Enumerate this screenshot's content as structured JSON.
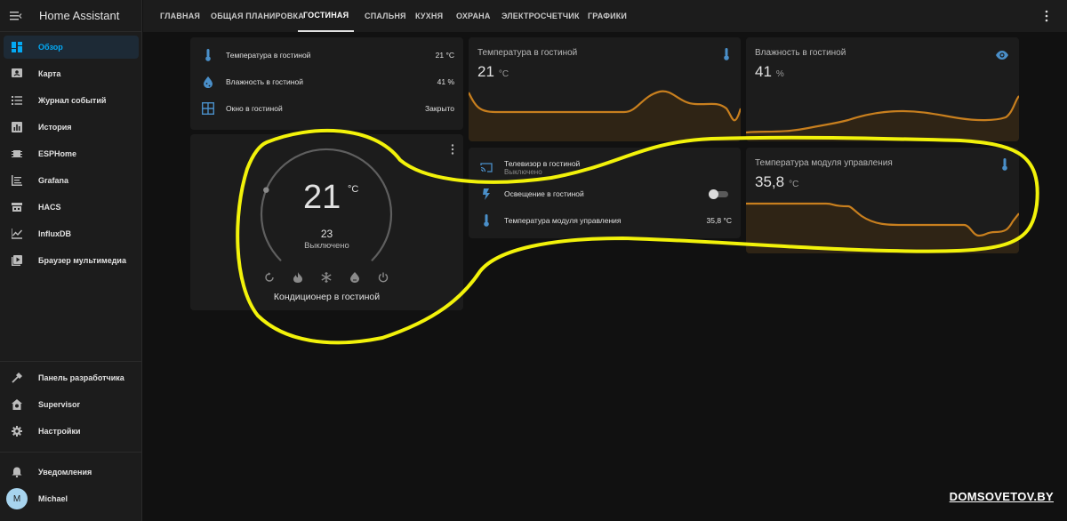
{
  "app": {
    "title": "Home Assistant"
  },
  "sidebar": {
    "items": [
      {
        "label": "Обзор",
        "icon": "dashboard-icon"
      },
      {
        "label": "Карта",
        "icon": "map-icon"
      },
      {
        "label": "Журнал событий",
        "icon": "logbook-icon"
      },
      {
        "label": "История",
        "icon": "history-icon"
      },
      {
        "label": "ESPHome",
        "icon": "esphome-icon"
      },
      {
        "label": "Grafana",
        "icon": "grafana-icon"
      },
      {
        "label": "HACS",
        "icon": "hacs-icon"
      },
      {
        "label": "InfluxDB",
        "icon": "influxdb-icon"
      },
      {
        "label": "Браузер мультимедиа",
        "icon": "media-browser-icon"
      }
    ],
    "bottom_items": [
      {
        "label": "Панель разработчика",
        "icon": "hammer-icon"
      },
      {
        "label": "Supervisor",
        "icon": "supervisor-icon"
      },
      {
        "label": "Настройки",
        "icon": "gear-icon"
      }
    ],
    "notifications": "Уведомления",
    "user": {
      "initial": "M",
      "name": "Michael"
    }
  },
  "tabs": [
    {
      "label": "ГЛАВНАЯ"
    },
    {
      "label": "ОБЩАЯ ПЛАНИРОВКА"
    },
    {
      "label": "ГОСТИНАЯ",
      "active": true
    },
    {
      "label": "СПАЛЬНЯ"
    },
    {
      "label": "КУХНЯ"
    },
    {
      "label": "ОХРАНА"
    },
    {
      "label": "ЭЛЕКТРОСЧЕТЧИК"
    },
    {
      "label": "ГРАФИКИ"
    }
  ],
  "entities_card": {
    "rows": [
      {
        "name": "Температура в гостиной",
        "value": "21 °C",
        "icon": "thermometer-icon"
      },
      {
        "name": "Влажность в гостиной",
        "value": "41 %",
        "icon": "water-percent-icon"
      },
      {
        "name": "Окно в гостиной",
        "value": "Закрыто",
        "icon": "window-icon"
      }
    ]
  },
  "thermostat": {
    "current": "21",
    "unit": "°C",
    "target": "23",
    "state": "Выключено",
    "name": "Кондиционер в гостиной",
    "setpoint_fraction": 0.1,
    "modes": [
      "auto-mode-icon",
      "heat-mode-icon",
      "cool-mode-icon",
      "dry-mode-icon",
      "power-icon"
    ]
  },
  "sensor_temp": {
    "name": "Температура в гостиной",
    "value": "21",
    "unit": "°C",
    "icon": "thermometer-icon"
  },
  "sensor_humidity": {
    "name": "Влажность в гостиной",
    "value": "41",
    "unit": "%",
    "icon": "eye-icon"
  },
  "sensor_module": {
    "name": "Температура модуля управления",
    "value": "35,8",
    "unit": "°C",
    "icon": "thermometer-icon"
  },
  "entities_card2": {
    "tv": {
      "name": "Телевизор в гостиной",
      "state": "Выключено",
      "icon": "cast-icon"
    },
    "light": {
      "name": "Освещение в гостиной",
      "icon": "flash-icon",
      "on": false
    },
    "module": {
      "name": "Температура модуля управления",
      "value": "35,8 °C",
      "icon": "thermometer-icon"
    }
  },
  "watermark": "DOMSOVETOV.BY",
  "colors": {
    "accent": "#03a9f4",
    "graph": "#c87f1e",
    "annotation": "#f2f20a",
    "icon": "#4a8fc9"
  }
}
